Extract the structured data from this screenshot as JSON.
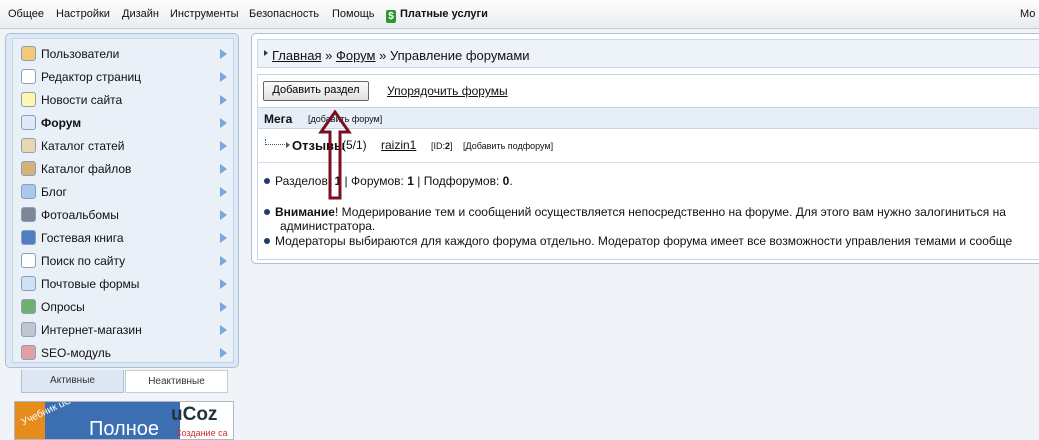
{
  "topbar": {
    "items": [
      "Общее",
      "Настройки",
      "Дизайн",
      "Инструменты",
      "Безопасность",
      "Помощь"
    ],
    "paid_label": "Платные услуги",
    "right_text": "Мо"
  },
  "sidebar": {
    "items": [
      {
        "label": "Пользователи",
        "icon": "user-icon"
      },
      {
        "label": "Редактор страниц",
        "icon": "page-icon"
      },
      {
        "label": "Новости сайта",
        "icon": "lightbulb-icon"
      },
      {
        "label": "Форум",
        "icon": "forum-icon",
        "active": true
      },
      {
        "label": "Каталог статей",
        "icon": "articles-icon"
      },
      {
        "label": "Каталог файлов",
        "icon": "files-icon"
      },
      {
        "label": "Блог",
        "icon": "blog-icon"
      },
      {
        "label": "Фотоальбомы",
        "icon": "camera-icon"
      },
      {
        "label": "Гостевая книга",
        "icon": "book-icon"
      },
      {
        "label": "Поиск по сайту",
        "icon": "search-icon"
      },
      {
        "label": "Почтовые формы",
        "icon": "mail-icon"
      },
      {
        "label": "Опросы",
        "icon": "poll-icon"
      },
      {
        "label": "Интернет-магазин",
        "icon": "cart-icon"
      },
      {
        "label": "SEO-модуль",
        "icon": "seo-icon"
      }
    ]
  },
  "tabs": {
    "active": "Активные",
    "inactive": "Неактивные"
  },
  "banner": {
    "text1": "Учебник uCoz",
    "text2": "Полное",
    "text3": "uCoz",
    "text4": "Создание са"
  },
  "breadcrumb": {
    "home": "Главная",
    "sep": "»",
    "forum": "Форум",
    "current": "Управление форумами"
  },
  "toolbar": {
    "add_section": "Добавить раздел",
    "order_forums": "Упорядочить форумы"
  },
  "category": {
    "name": "Мега",
    "add_forum": "[добавить форум]"
  },
  "forum": {
    "name": "Отзывы",
    "counts": "(5/1)",
    "moderator": "raizin1",
    "id_prefix": "[ID:",
    "id": "2",
    "id_suffix": "]",
    "add_subforum": "[Добавить подфорум]"
  },
  "stats": {
    "sections_label": "Разделов:",
    "sections_value": "1",
    "forums_label": "Форумов:",
    "forums_value": "1",
    "subforums_label": "Подфорумов:",
    "subforums_value": "0"
  },
  "notes": {
    "attention_label": "Внимание",
    "attention_text": "! Модерирование тем и сообщений осуществляется непосредственно на форуме. Для этого вам нужно залогиниться на",
    "attention_line2": "администратора.",
    "moderators_text": "Модераторы выбираются для каждого форума отдельно. Модератор форума имеет все возможности управления темами и сообще"
  },
  "colors": {
    "accent": "#7aa7e0",
    "annotation_arrow": "#7a0f22"
  }
}
